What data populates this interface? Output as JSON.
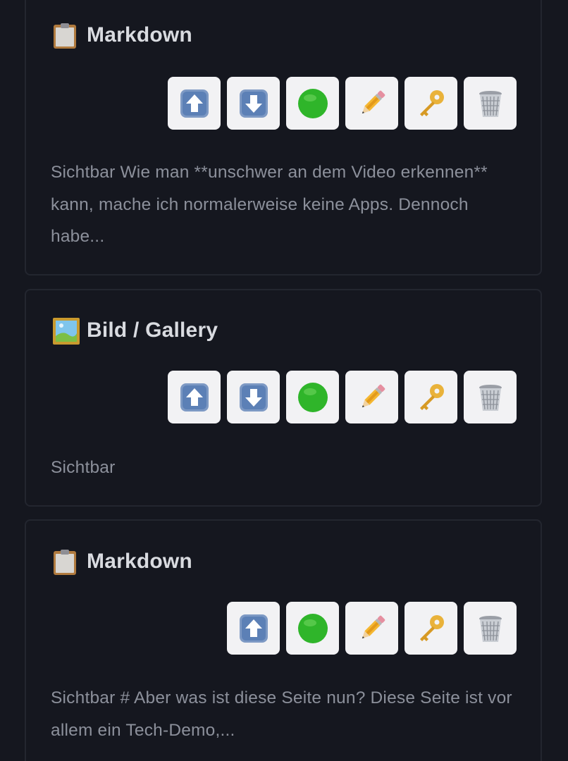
{
  "cards": [
    {
      "type_icon": "clipboard-icon",
      "title": "Markdown",
      "buttons": [
        "move-up-icon",
        "move-down-icon",
        "green-circle-icon",
        "pencil-icon",
        "key-icon",
        "trash-icon"
      ],
      "summary": "Sichtbar Wie man **unschwer an dem Video erkennen** kann, mache ich normalerweise keine Apps. Dennoch habe..."
    },
    {
      "type_icon": "framed-picture-icon",
      "title": "Bild / Gallery",
      "buttons": [
        "move-up-icon",
        "move-down-icon",
        "green-circle-icon",
        "pencil-icon",
        "key-icon",
        "trash-icon"
      ],
      "summary": "Sichtbar"
    },
    {
      "type_icon": "clipboard-icon",
      "title": "Markdown",
      "buttons": [
        "move-up-icon",
        "green-circle-icon",
        "pencil-icon",
        "key-icon",
        "trash-icon"
      ],
      "summary": "Sichtbar # Aber was ist diese Seite nun? Diese Seite ist vor allem ein Tech-Demo,..."
    }
  ],
  "colors": {
    "background": "#15171f",
    "card_border": "#23262f",
    "title": "#d9dbe0",
    "summary": "#8c909b",
    "button_bg": "#f2f2f4",
    "status_green": "#2fb52a"
  }
}
